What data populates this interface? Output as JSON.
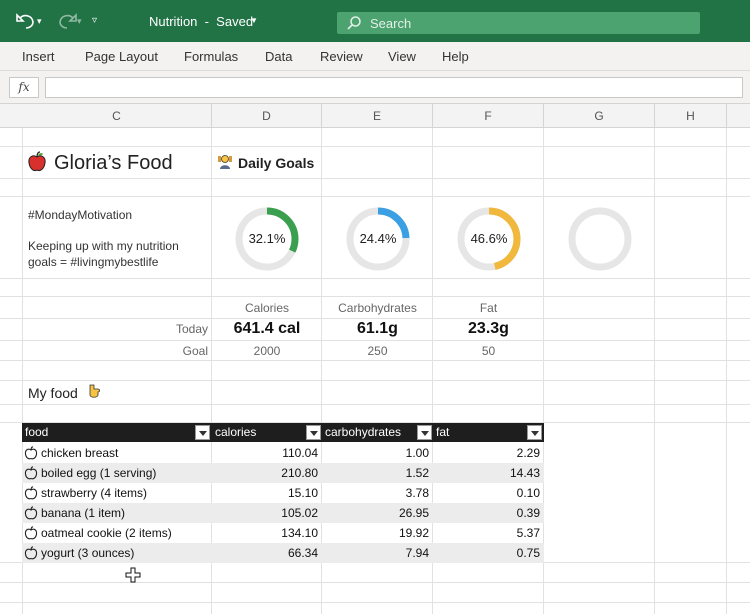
{
  "titlebar": {
    "doc_title": "Nutrition  -  Saved",
    "search_placeholder": "Search"
  },
  "ribbon": {
    "tabs": [
      "Insert",
      "Page Layout",
      "Formulas",
      "Data",
      "Review",
      "View",
      "Help"
    ]
  },
  "formula_bar": {
    "fx_label": "fx",
    "value": ""
  },
  "columns": [
    "C",
    "D",
    "E",
    "F",
    "G",
    "H"
  ],
  "sheet": {
    "title": "Gloria’s Food",
    "daily_goals": "Daily Goals",
    "hashtag": "#MondayMotivation",
    "note_line1": "Keeping up with my nutrition",
    "note_line2": "goals = #livingmybestlife",
    "donuts": [
      {
        "label": "32.1%",
        "value": 32.1,
        "color": "#3aa04f"
      },
      {
        "label": "24.4%",
        "value": 24.4,
        "color": "#3a9fe3"
      },
      {
        "label": "46.6%",
        "value": 46.6,
        "color": "#f0b83c"
      },
      {
        "label": "",
        "value": 0,
        "color": "#e6e6e6"
      }
    ],
    "metric_headers": [
      "Calories",
      "Carbohydrates",
      "Fat"
    ],
    "today_label": "Today",
    "goal_label": "Goal",
    "today_values": [
      "641.4 cal",
      "61.1g",
      "23.3g"
    ],
    "goal_values": [
      "2000",
      "250",
      "50"
    ],
    "my_food_label": "My food"
  },
  "table": {
    "headers": [
      "food",
      "calories",
      "carbohydrates",
      "fat"
    ],
    "rows": [
      {
        "food": "chicken breast",
        "calories": "110.04",
        "carbohydrates": "1.00",
        "fat": "2.29"
      },
      {
        "food": "boiled egg (1 serving)",
        "calories": "210.80",
        "carbohydrates": "1.52",
        "fat": "14.43"
      },
      {
        "food": "strawberry (4 items)",
        "calories": "15.10",
        "carbohydrates": "3.78",
        "fat": "0.10"
      },
      {
        "food": "banana (1 item)",
        "calories": "105.02",
        "carbohydrates": "26.95",
        "fat": "0.39"
      },
      {
        "food": "oatmeal cookie (2 items)",
        "calories": "134.10",
        "carbohydrates": "19.92",
        "fat": "5.37"
      },
      {
        "food": "yogurt (3 ounces)",
        "calories": "66.34",
        "carbohydrates": "7.94",
        "fat": "0.75"
      }
    ]
  },
  "colors": {
    "excel_green": "#217346",
    "search_bg": "#4ca36f",
    "table_header": "#1e1e1e"
  }
}
